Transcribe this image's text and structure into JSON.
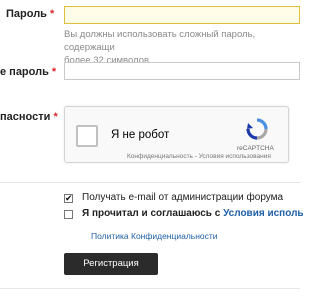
{
  "form": {
    "password_label": "Пароль",
    "password_hint": "Вы должны использовать сложный пароль, содержащи более 32 символов",
    "password_hint_line1": "Вы должны использовать сложный пароль, содержащи",
    "password_hint_line2": "более 32 символов",
    "confirm_label": "е пароль",
    "captcha_label": "пасности",
    "required_mark": "*"
  },
  "captcha": {
    "checkbox_text": "Я не робот",
    "brand": "reCAPTCHA",
    "links": "Конфиденциальность - Условия использования",
    "checked": false
  },
  "options": {
    "email_label": "Получать e-mail от администрации форума",
    "email_checked": true,
    "terms_prefix": "Я прочитал и соглашаюсь с",
    "terms_link": "Условия исполь",
    "terms_checked": false,
    "privacy_link": "Политика Конфиденциальности"
  },
  "submit": {
    "label": "Регистрация"
  }
}
